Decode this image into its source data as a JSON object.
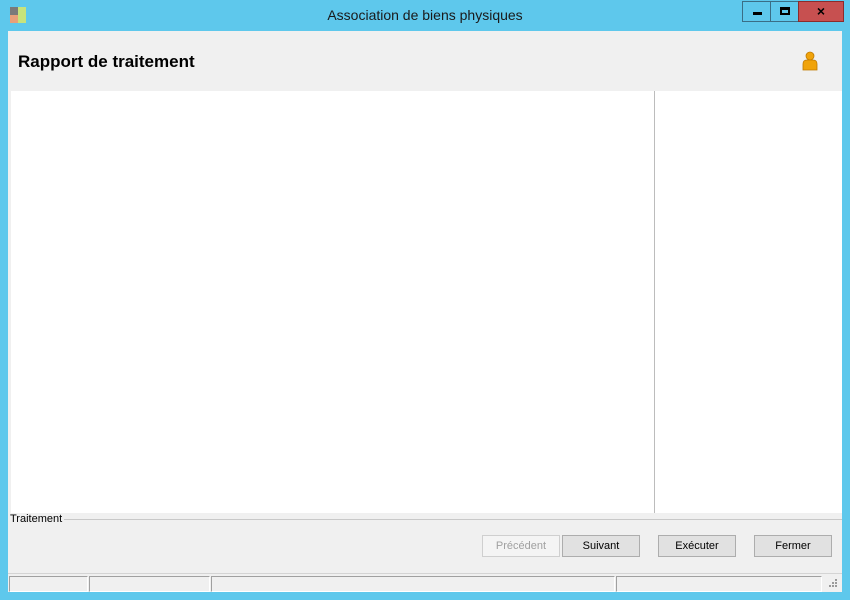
{
  "window": {
    "title": "Association de biens physiques",
    "controls": {
      "minimize": "minimize",
      "maximize": "maximize",
      "close": "×"
    }
  },
  "header": {
    "title": "Rapport de traitement",
    "icon": "user-icon"
  },
  "group": {
    "label": "Traitement"
  },
  "buttons": {
    "previous": "Précédent",
    "next": "Suivant",
    "execute": "Exécuter",
    "close": "Fermer"
  },
  "status": {
    "panels": [
      "",
      "",
      "",
      ""
    ]
  },
  "colors": {
    "titlebar": "#5ec8ec",
    "close_button": "#c75050",
    "user_icon": "#f0a30a"
  }
}
